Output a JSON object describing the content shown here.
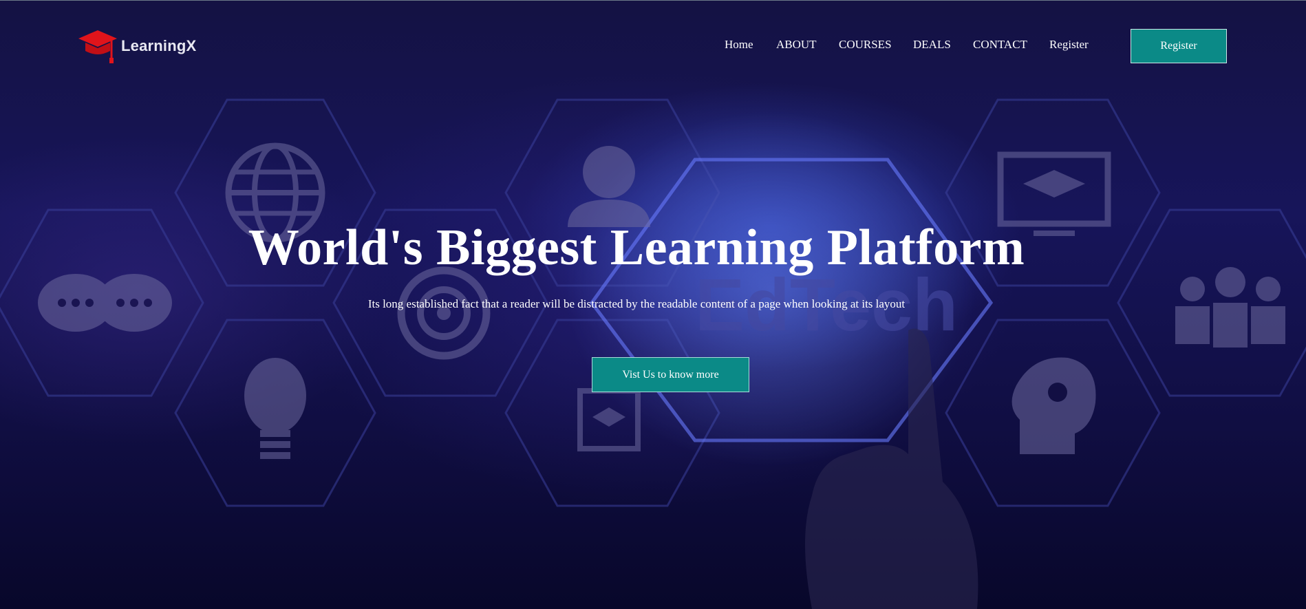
{
  "brand": {
    "name": "LearningX",
    "logo_icon": "graduation-cap-icon",
    "logo_color": "#e0141b"
  },
  "nav": {
    "links": [
      {
        "label": "Home"
      },
      {
        "label": "ABOUT"
      },
      {
        "label": "COURSES"
      },
      {
        "label": "DEALS"
      },
      {
        "label": "CONTACT"
      },
      {
        "label": "Register"
      }
    ],
    "register_button": "Register"
  },
  "hero": {
    "title": "World's Biggest Learning Platform",
    "subtitle": "Its long established fact that a reader will be distracted by the readable content of a page when looking at its layout",
    "cta_label": "Vist Us to know more",
    "background_watermark": "EdTech"
  },
  "colors": {
    "accent": "#0b8a87",
    "background": "#0b0a2e",
    "text": "#ffffff"
  }
}
